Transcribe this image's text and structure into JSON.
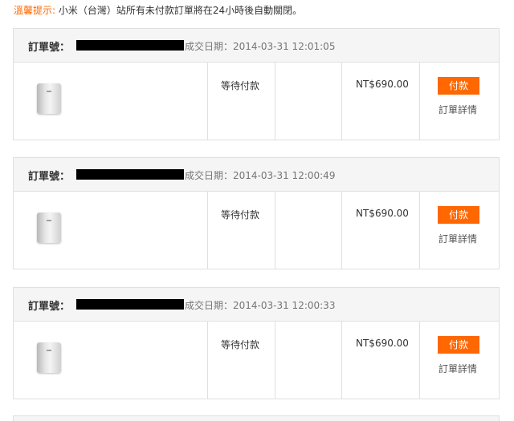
{
  "notice": {
    "label": "溫馨提示:",
    "text": "小米（台灣）站所有未付款訂單將在24小時後自動關閉。"
  },
  "orders": [
    {
      "order_no_label": "訂單號：",
      "date": "成交日期：2014-03-31 12:01:05",
      "status": "等待付款",
      "price": "NT$690.00",
      "pay_label": "付款",
      "detail_label": "訂單詳情"
    },
    {
      "order_no_label": "訂單號：",
      "date": "成交日期：2014-03-31 12:00:49",
      "status": "等待付款",
      "price": "NT$690.00",
      "pay_label": "付款",
      "detail_label": "訂單詳情"
    },
    {
      "order_no_label": "訂單號：",
      "date": "成交日期：2014-03-31 12:00:33",
      "status": "等待付款",
      "price": "NT$690.00",
      "pay_label": "付款",
      "detail_label": "訂單詳情"
    }
  ],
  "colors": {
    "accent": "#ff6700",
    "border": "#e0e0e0",
    "header_bg": "#f5f5f5"
  }
}
